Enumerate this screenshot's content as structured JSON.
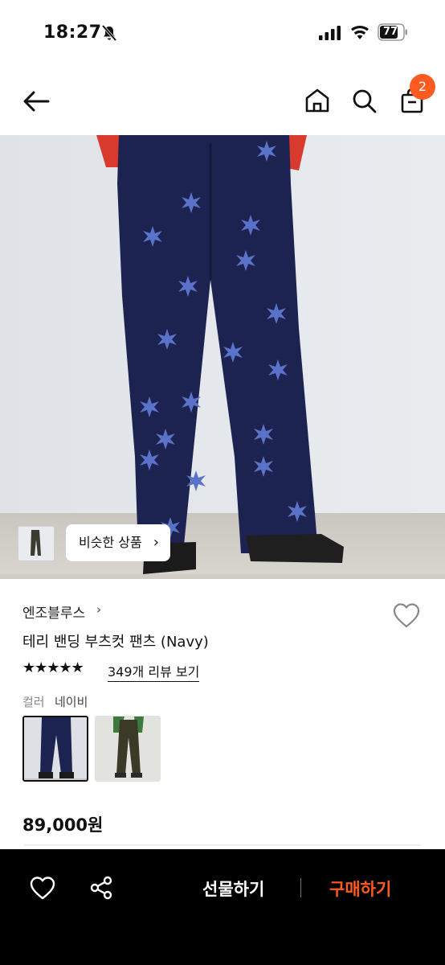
{
  "status_bar": {
    "time": "18:27",
    "battery": "77"
  },
  "header": {
    "cart_count": "2",
    "icons": [
      "back-arrow-icon",
      "home-icon",
      "search-icon",
      "shopping-bag-icon"
    ]
  },
  "hero": {
    "similar_products_label": "비슷한 상품",
    "similar_products_chevron": "›"
  },
  "product": {
    "brand": "엔조블루스",
    "brand_chevron": "›",
    "name": "테리 밴딩 부츠컷 팬츠 (Navy)",
    "stars": "★★★★★",
    "rating_stars": 5,
    "review_link": "349개 리뷰 보기",
    "option_label": "컬러",
    "option_value": "네이비",
    "price": "89,000원"
  },
  "bottom_bar": {
    "gift_label": "선물하기",
    "buy_label": "구매하기",
    "accent_color": "#ff5a1f"
  }
}
